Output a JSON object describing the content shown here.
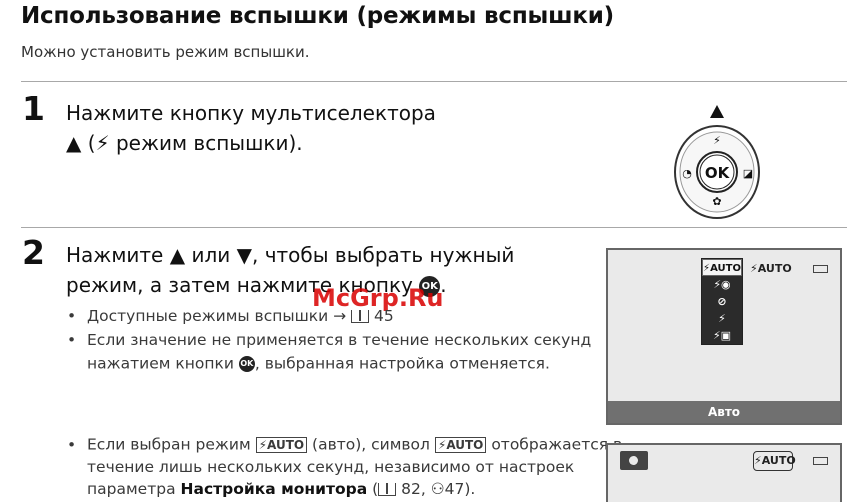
{
  "header": {
    "title": "Использование вспышки (режимы вспышки)",
    "subtitle": "Можно установить режим вспышки."
  },
  "step1": {
    "number": "1",
    "line1": "Нажмите кнопку мультиселектора",
    "line2": "(",
    "line2_rest": " режим вспышки).",
    "dial_center": "OK"
  },
  "step2": {
    "number": "2",
    "line1_a": "Нажмите",
    "line1_b": "или",
    "line1_c": ", чтобы выбрать нужный",
    "line2": "режим, а затем нажмите кнопку",
    "line2_end": ".",
    "bullets": [
      {
        "text": "Доступные режимы вспышки →",
        "page": "45"
      },
      {
        "line1": "Если значение не применяется в течение нескольких секунд",
        "line2a": "нажатием кнопки",
        "line2b": ", выбранная настройка отменяется."
      },
      {
        "line1a": "Если выбран режим",
        "line1b": "(авто), символ",
        "line1c": "отображается в",
        "line2": "течение лишь нескольких секунд, независимо от настроек",
        "line3a": "параметра",
        "line3_bold": "Настройка монитора",
        "line3b": "(",
        "line3c": "82,",
        "line3d": "47)."
      }
    ],
    "ok_label": "OK",
    "flash_auto": "⚡AUTO"
  },
  "screen1": {
    "menu_items": [
      "⚡AUTO",
      "⚡◉",
      "⊘",
      "⚡",
      "⚡▣"
    ],
    "selected_index": 0,
    "top_label": "⚡AUTO",
    "bottom_label": "Авто"
  },
  "screen2": {
    "flash_indicator": "⚡AUTO"
  },
  "watermark": "McGrp.Ru"
}
